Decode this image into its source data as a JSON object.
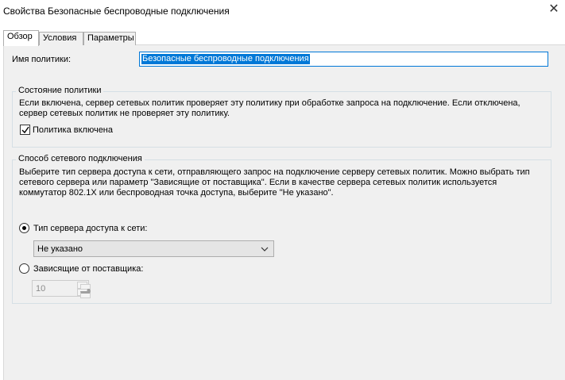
{
  "window": {
    "title": "Свойства Безопасные беспроводные подключения",
    "close_symbol": "✕"
  },
  "tabs": [
    {
      "label": "Обзор",
      "active": true
    },
    {
      "label": "Условия",
      "active": false
    },
    {
      "label": "Параметры",
      "active": false
    }
  ],
  "policy_name": {
    "label": "Имя политики:",
    "value": "Безопасные беспроводные подключения"
  },
  "policy_state": {
    "title": "Состояние политики",
    "description_line1": "Если включена, сервер сетевых политик проверяет эту политику при обработке запроса на подключение. Если отключена,",
    "description_line2": "сервер сетевых политик не проверяет эту политику.",
    "checkbox_label": "Политика включена",
    "checked": true
  },
  "connection_method": {
    "title": "Способ сетевого подключения",
    "description_line1": "Выберите тип сервера доступа к сети, отправляющего запрос на подключение серверу сетевых политик. Можно выбрать тип",
    "description_line2": "сетевого сервера или параметр \"Зависящие от поставщика\". Если в качестве сервера сетевых политик используется",
    "description_line3": "коммутатор 802.1X или беспроводная точка доступа, выберите \"Не указано\".",
    "radio_nas_label": "Тип сервера доступа к сети:",
    "radio_nas_selected": true,
    "nas_type_value": "Не указано",
    "radio_vendor_label": "Зависящие от поставщика:",
    "radio_vendor_selected": false,
    "vendor_value": "10"
  }
}
